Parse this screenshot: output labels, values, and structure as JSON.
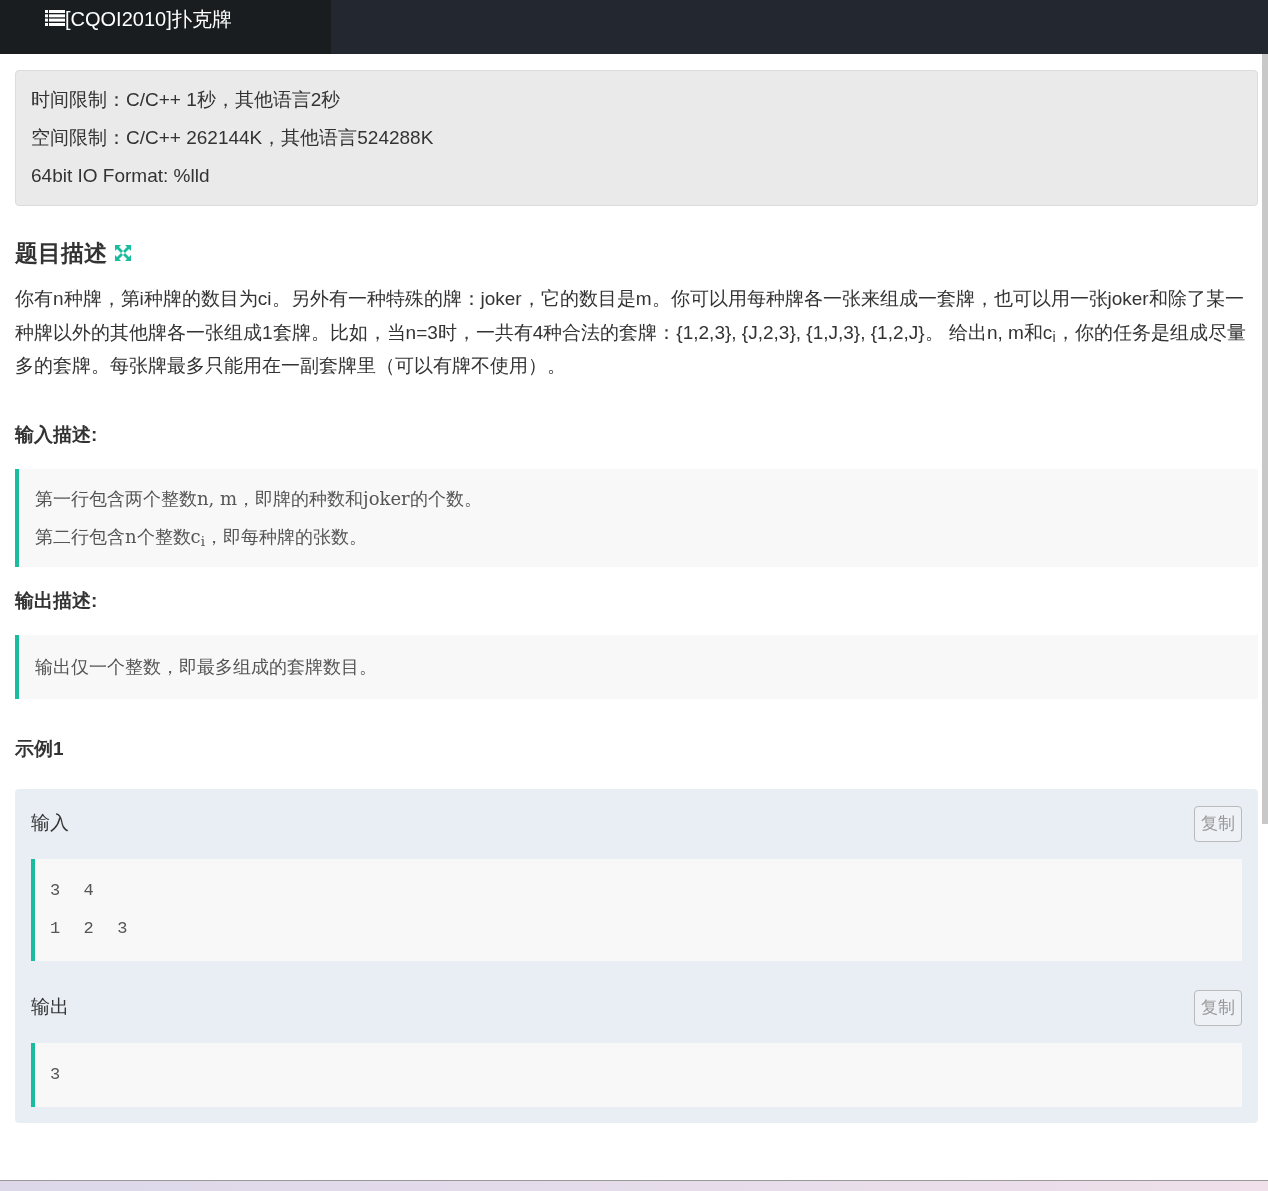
{
  "header": {
    "title": "[CQOI2010]扑克牌"
  },
  "limits": [
    "时间限制：C/C++ 1秒，其他语言2秒",
    "空间限制：C/C++ 262144K，其他语言524288K",
    "64bit IO Format: %lld"
  ],
  "description": {
    "title": "题目描述",
    "text": "你有n种牌，第i种牌的数目为ci。另外有一种特殊的牌：joker，它的数目是m。你可以用每种牌各一张来组成一套牌，也可以用一张joker和除了某一种牌以外的其他牌各一张组成1套牌。比如，当n=3时，一共有4种合法的套牌：{1,2,3}, {J,2,3}, {1,J,3}, {1,2,J}。 给出n, m和c$_{i}$，你的任务是组成尽量多的套牌。每张牌最多只能用在一副套牌里（可以有牌不使用）。"
  },
  "input_desc": {
    "title": "输入描述:",
    "lines": [
      "第一行包含两个整数n, m，即牌的种数和joker的个数。",
      "第二行包含n个整数c$_{i}$，即每种牌的张数。"
    ]
  },
  "output_desc": {
    "title": "输出描述:",
    "lines": [
      "输出仅一个整数，即最多组成的套牌数目。"
    ]
  },
  "example": {
    "title": "示例1",
    "blocks": [
      {
        "label": "输入",
        "copy": "复制",
        "lines": [
          "3 4",
          "1 2 3"
        ]
      },
      {
        "label": "输出",
        "copy": "复制",
        "lines": [
          "3"
        ]
      }
    ]
  }
}
